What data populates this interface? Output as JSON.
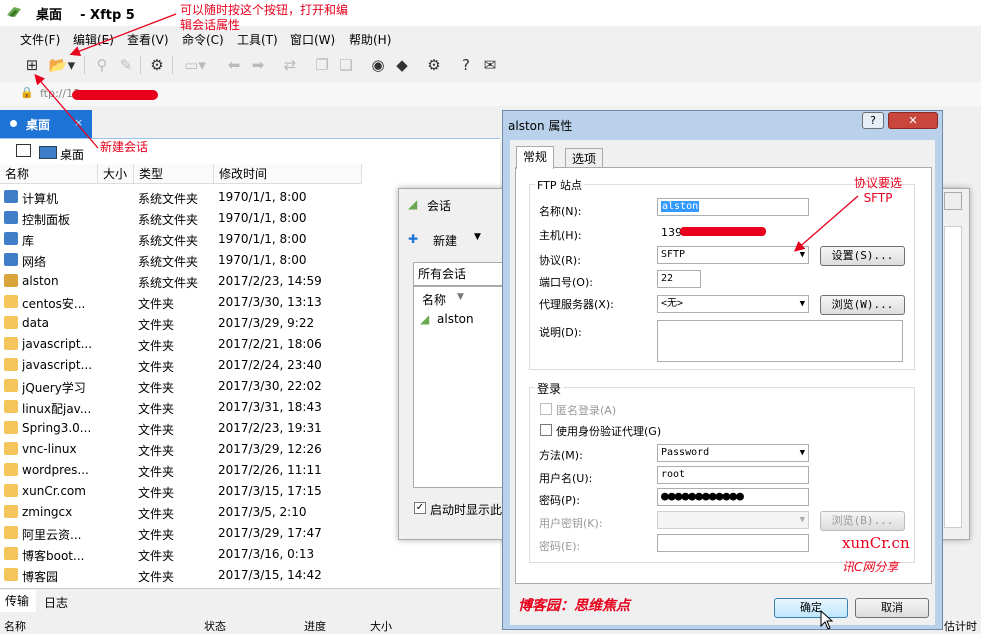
{
  "window": {
    "app_name": "桌面",
    "title_suffix": "- Xftp 5"
  },
  "menu": [
    "文件(F)",
    "编辑(E)",
    "查看(V)",
    "命令(C)",
    "工具(T)",
    "窗口(W)",
    "帮助(H)"
  ],
  "address": {
    "text": "ftp://13"
  },
  "tab": {
    "label": "桌面",
    "close": "×"
  },
  "path": {
    "label": "桌面"
  },
  "columns": [
    "名称",
    "大小",
    "类型",
    "修改时间"
  ],
  "files": [
    {
      "name": "计算机",
      "type": "系统文件夹",
      "modified": "1970/1/1, 8:00",
      "icon": "system"
    },
    {
      "name": "控制面板",
      "type": "系统文件夹",
      "modified": "1970/1/1, 8:00",
      "icon": "system"
    },
    {
      "name": "库",
      "type": "系统文件夹",
      "modified": "1970/1/1, 8:00",
      "icon": "system"
    },
    {
      "name": "网络",
      "type": "系统文件夹",
      "modified": "1970/1/1, 8:00",
      "icon": "system"
    },
    {
      "name": "alston",
      "type": "系统文件夹",
      "modified": "2017/2/23, 14:59",
      "icon": "system"
    },
    {
      "name": "centos安...",
      "type": "文件夹",
      "modified": "2017/3/30, 13:13",
      "icon": "folder"
    },
    {
      "name": "data",
      "type": "文件夹",
      "modified": "2017/3/29, 9:22",
      "icon": "folder"
    },
    {
      "name": "javascript...",
      "type": "文件夹",
      "modified": "2017/2/21, 18:06",
      "icon": "folder"
    },
    {
      "name": "javascript...",
      "type": "文件夹",
      "modified": "2017/2/24, 23:40",
      "icon": "folder"
    },
    {
      "name": "jQuery学习",
      "type": "文件夹",
      "modified": "2017/3/30, 22:02",
      "icon": "folder"
    },
    {
      "name": "linux配jav...",
      "type": "文件夹",
      "modified": "2017/3/31, 18:43",
      "icon": "folder"
    },
    {
      "name": "Spring3.0...",
      "type": "文件夹",
      "modified": "2017/2/23, 19:31",
      "icon": "folder"
    },
    {
      "name": "vnc-linux",
      "type": "文件夹",
      "modified": "2017/3/29, 12:26",
      "icon": "folder"
    },
    {
      "name": "wordpres...",
      "type": "文件夹",
      "modified": "2017/2/26, 11:11",
      "icon": "folder"
    },
    {
      "name": "xunCr.com",
      "type": "文件夹",
      "modified": "2017/3/15, 17:15",
      "icon": "folder"
    },
    {
      "name": "zmingcx",
      "type": "文件夹",
      "modified": "2017/3/5, 2:10",
      "icon": "folder"
    },
    {
      "name": "阿里云资...",
      "type": "文件夹",
      "modified": "2017/3/29, 17:47",
      "icon": "folder"
    },
    {
      "name": "博客boot...",
      "type": "文件夹",
      "modified": "2017/3/16, 0:13",
      "icon": "folder"
    },
    {
      "name": "博客园",
      "type": "文件夹",
      "modified": "2017/3/15, 14:42",
      "icon": "folder"
    }
  ],
  "bottom": {
    "tab_transfer": "传输",
    "tab_log": "日志",
    "cols": [
      "名称",
      "状态",
      "进度",
      "大小",
      "估计时"
    ]
  },
  "session": {
    "title": "会话",
    "new": "新建",
    "all_sessions": "所有会话",
    "col_name": "名称",
    "item": "alston",
    "startup_check": "启动时显示此"
  },
  "props": {
    "title": "alston 属性",
    "tabs": [
      "常规",
      "选项"
    ],
    "ftp_group": "FTP 站点",
    "name_label": "名称(N):",
    "name_value": "alston",
    "host_label": "主机(H):",
    "host_value": "139",
    "protocol_label": "协议(R):",
    "protocol_value": "SFTP",
    "settings_btn": "设置(S)...",
    "port_label": "端口号(O):",
    "port_value": "22",
    "proxy_label": "代理服务器(X):",
    "proxy_value": "<无>",
    "browse_btn": "浏览(W)...",
    "desc_label": "说明(D):",
    "login_group": "登录",
    "anon": "匿名登录(A)",
    "agent": "使用身份验证代理(G)",
    "method_label": "方法(M):",
    "method_value": "Password",
    "user_label": "用户名(U):",
    "user_value": "root",
    "pass_label": "密码(P):",
    "pass_value": "●●●●●●●●●●●●",
    "key_label": "用户密钥(K):",
    "key_browse": "浏览(B)...",
    "passphrase_label": "密码(E):",
    "ok": "确定",
    "cancel": "取消",
    "help_btn": "?",
    "close_btn": "✕"
  },
  "annotations": {
    "top": "可以随时按这个按钮，打开和编辑会话属性",
    "new_session": "新建会话",
    "protocol": "协议要选SFTP",
    "watermark1": "xunCr.cn",
    "watermark2": "讯C网分享",
    "watermark3": "博客园：思维焦点"
  },
  "colors": {
    "accent": "#1e73d6",
    "annotation": "#e8001c"
  }
}
